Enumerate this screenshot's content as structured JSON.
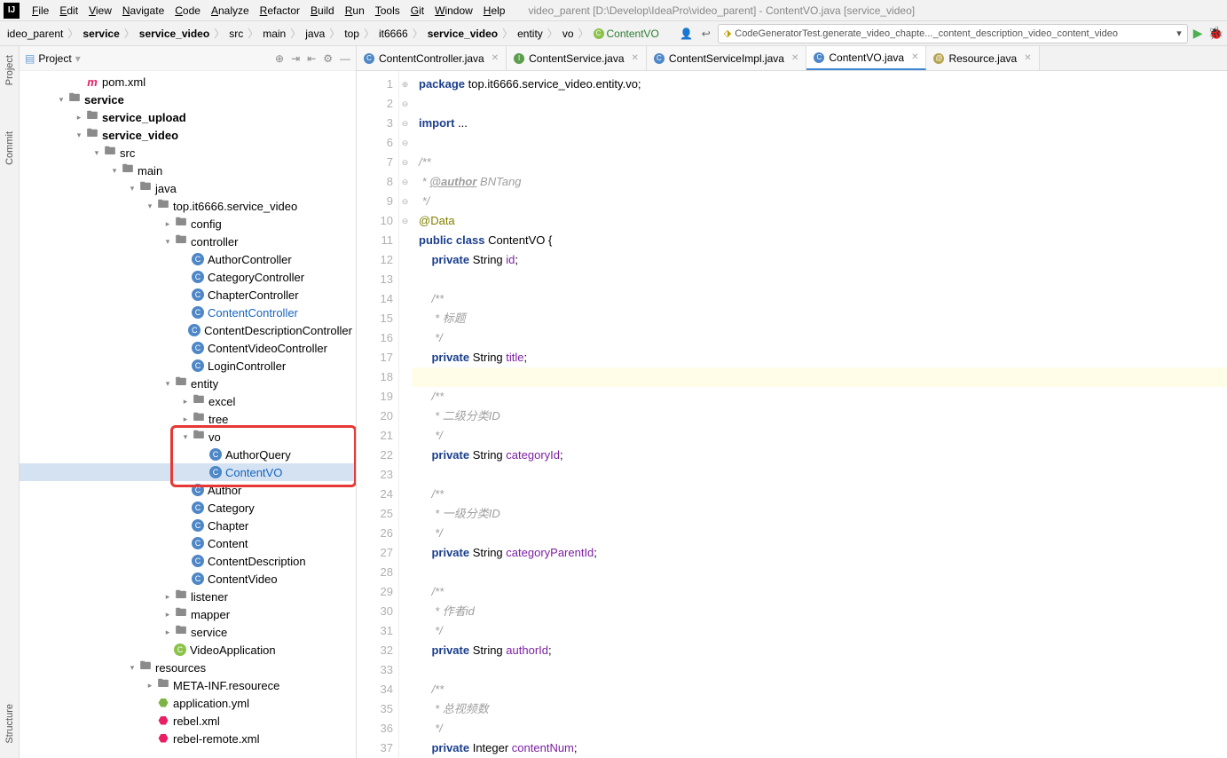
{
  "window": {
    "title": "video_parent [D:\\Develop\\IdeaPro\\video_parent] - ContentVO.java [service_video]"
  },
  "menu": [
    "File",
    "Edit",
    "View",
    "Navigate",
    "Code",
    "Analyze",
    "Refactor",
    "Build",
    "Run",
    "Tools",
    "Git",
    "Window",
    "Help"
  ],
  "breadcrumbs": [
    "ideo_parent",
    "service",
    "service_video",
    "src",
    "main",
    "java",
    "top",
    "it6666",
    "service_video",
    "entity",
    "vo",
    "ContentVO"
  ],
  "runconfig": "CodeGeneratorTest.generate_video_chapte..._content_description_video_content_video",
  "sidebar": {
    "title": "Project",
    "items": [
      {
        "ind": 3,
        "arrow": "",
        "ic": "m",
        "label": "pom.xml"
      },
      {
        "ind": 2,
        "arrow": "▾",
        "ic": "fld",
        "label": "service",
        "bold": true
      },
      {
        "ind": 3,
        "arrow": "▸",
        "ic": "fld",
        "label": "service_upload",
        "bold": true
      },
      {
        "ind": 3,
        "arrow": "▾",
        "ic": "fld",
        "label": "service_video",
        "bold": true
      },
      {
        "ind": 4,
        "arrow": "▾",
        "ic": "fld",
        "label": "src"
      },
      {
        "ind": 5,
        "arrow": "▾",
        "ic": "fld",
        "label": "main"
      },
      {
        "ind": 6,
        "arrow": "▾",
        "ic": "fld",
        "label": "java"
      },
      {
        "ind": 7,
        "arrow": "▾",
        "ic": "pkg",
        "label": "top.it6666.service_video"
      },
      {
        "ind": 8,
        "arrow": "▸",
        "ic": "pkg",
        "label": "config"
      },
      {
        "ind": 8,
        "arrow": "▾",
        "ic": "pkg",
        "label": "controller"
      },
      {
        "ind": 9,
        "arrow": "",
        "ic": "cls",
        "label": "AuthorController"
      },
      {
        "ind": 9,
        "arrow": "",
        "ic": "cls",
        "label": "CategoryController"
      },
      {
        "ind": 9,
        "arrow": "",
        "ic": "cls",
        "label": "ChapterController"
      },
      {
        "ind": 9,
        "arrow": "",
        "ic": "cls",
        "label": "ContentController",
        "link": true
      },
      {
        "ind": 9,
        "arrow": "",
        "ic": "cls",
        "label": "ContentDescriptionController"
      },
      {
        "ind": 9,
        "arrow": "",
        "ic": "cls",
        "label": "ContentVideoController"
      },
      {
        "ind": 9,
        "arrow": "",
        "ic": "cls",
        "label": "LoginController"
      },
      {
        "ind": 8,
        "arrow": "▾",
        "ic": "pkg",
        "label": "entity"
      },
      {
        "ind": 9,
        "arrow": "▸",
        "ic": "pkg",
        "label": "excel"
      },
      {
        "ind": 9,
        "arrow": "▸",
        "ic": "pkg",
        "label": "tree"
      },
      {
        "ind": 9,
        "arrow": "▾",
        "ic": "pkg",
        "label": "vo"
      },
      {
        "ind": 10,
        "arrow": "",
        "ic": "cls",
        "label": "AuthorQuery"
      },
      {
        "ind": 10,
        "arrow": "",
        "ic": "cls",
        "label": "ContentVO",
        "link": true,
        "sel": true
      },
      {
        "ind": 9,
        "arrow": "",
        "ic": "cls",
        "label": "Author"
      },
      {
        "ind": 9,
        "arrow": "",
        "ic": "cls",
        "label": "Category"
      },
      {
        "ind": 9,
        "arrow": "",
        "ic": "cls",
        "label": "Chapter"
      },
      {
        "ind": 9,
        "arrow": "",
        "ic": "cls",
        "label": "Content"
      },
      {
        "ind": 9,
        "arrow": "",
        "ic": "cls",
        "label": "ContentDescription"
      },
      {
        "ind": 9,
        "arrow": "",
        "ic": "cls",
        "label": "ContentVideo"
      },
      {
        "ind": 8,
        "arrow": "▸",
        "ic": "pkg",
        "label": "listener"
      },
      {
        "ind": 8,
        "arrow": "▸",
        "ic": "pkg",
        "label": "mapper"
      },
      {
        "ind": 8,
        "arrow": "▸",
        "ic": "pkg",
        "label": "service"
      },
      {
        "ind": 8,
        "arrow": "",
        "ic": "cls-green",
        "label": "VideoApplication"
      },
      {
        "ind": 6,
        "arrow": "▾",
        "ic": "fld",
        "label": "resources"
      },
      {
        "ind": 7,
        "arrow": "▸",
        "ic": "fld",
        "label": "META-INF.resourece"
      },
      {
        "ind": 7,
        "arrow": "",
        "ic": "yml",
        "label": "application.yml"
      },
      {
        "ind": 7,
        "arrow": "",
        "ic": "xml",
        "label": "rebel.xml"
      },
      {
        "ind": 7,
        "arrow": "",
        "ic": "xml",
        "label": "rebel-remote.xml"
      }
    ]
  },
  "tabs": [
    {
      "ic": "c",
      "label": "ContentController.java"
    },
    {
      "ic": "i",
      "label": "ContentService.java"
    },
    {
      "ic": "c",
      "label": "ContentServiceImpl.java"
    },
    {
      "ic": "c",
      "label": "ContentVO.java",
      "active": true
    },
    {
      "ic": "at",
      "label": "Resource.java"
    }
  ],
  "code": {
    "lines": [
      {
        "n": 1,
        "html": "<span class='kw'>package</span> top.it6666.service_video.entity.vo;"
      },
      {
        "n": 2,
        "html": ""
      },
      {
        "n": 3,
        "html": "<span class='kw'>import</span> ...",
        "fold": "⊕"
      },
      {
        "n": 6,
        "html": ""
      },
      {
        "n": 7,
        "html": "<span class='cm'>/**</span>",
        "fold": "⊖"
      },
      {
        "n": 8,
        "html": "<span class='cm'> * </span><span class='cm-tag'>@author</span><span class='cm'> BNTang</span>"
      },
      {
        "n": 9,
        "html": "<span class='cm'> */</span>"
      },
      {
        "n": 10,
        "html": "<span class='an'>@Data</span>"
      },
      {
        "n": 11,
        "html": "<span class='kw'>public</span> <span class='kw'>class</span> ContentVO {",
        "fold": "⊖"
      },
      {
        "n": 12,
        "html": "    <span class='kw'>private</span> String <span class='fld'>id</span>;"
      },
      {
        "n": 13,
        "html": ""
      },
      {
        "n": 14,
        "html": "    <span class='cm'>/**</span>",
        "fold": "⊖"
      },
      {
        "n": 15,
        "html": "    <span class='cm'> * 标题</span>"
      },
      {
        "n": 16,
        "html": "    <span class='cm'> */</span>"
      },
      {
        "n": 17,
        "html": "    <span class='kw'>private</span> String <span class='fld'>title</span>;"
      },
      {
        "n": 18,
        "html": "",
        "hl": true
      },
      {
        "n": 19,
        "html": "    <span class='cm'>/**</span>",
        "fold": "⊖"
      },
      {
        "n": 20,
        "html": "    <span class='cm'> * 二级分类ID</span>"
      },
      {
        "n": 21,
        "html": "    <span class='cm'> */</span>"
      },
      {
        "n": 22,
        "html": "    <span class='kw'>private</span> String <span class='fld'>categoryId</span>;"
      },
      {
        "n": 23,
        "html": ""
      },
      {
        "n": 24,
        "html": "    <span class='cm'>/**</span>",
        "fold": "⊖"
      },
      {
        "n": 25,
        "html": "    <span class='cm'> * 一级分类ID</span>"
      },
      {
        "n": 26,
        "html": "    <span class='cm'> */</span>"
      },
      {
        "n": 27,
        "html": "    <span class='kw'>private</span> String <span class='fld'>categoryParentId</span>;"
      },
      {
        "n": 28,
        "html": ""
      },
      {
        "n": 29,
        "html": "    <span class='cm'>/**</span>",
        "fold": "⊖"
      },
      {
        "n": 30,
        "html": "    <span class='cm'> * 作者id</span>"
      },
      {
        "n": 31,
        "html": "    <span class='cm'> */</span>"
      },
      {
        "n": 32,
        "html": "    <span class='kw'>private</span> String <span class='fld'>authorId</span>;"
      },
      {
        "n": 33,
        "html": ""
      },
      {
        "n": 34,
        "html": "    <span class='cm'>/**</span>",
        "fold": "⊖"
      },
      {
        "n": 35,
        "html": "    <span class='cm'> * 总视频数</span>"
      },
      {
        "n": 36,
        "html": "    <span class='cm'> */</span>"
      },
      {
        "n": 37,
        "html": "    <span class='kw'>private</span> Integer <span class='fld'>contentNum</span>;"
      }
    ]
  },
  "leftTabs": {
    "project": "Project",
    "commit": "Commit",
    "structure": "Structure"
  }
}
